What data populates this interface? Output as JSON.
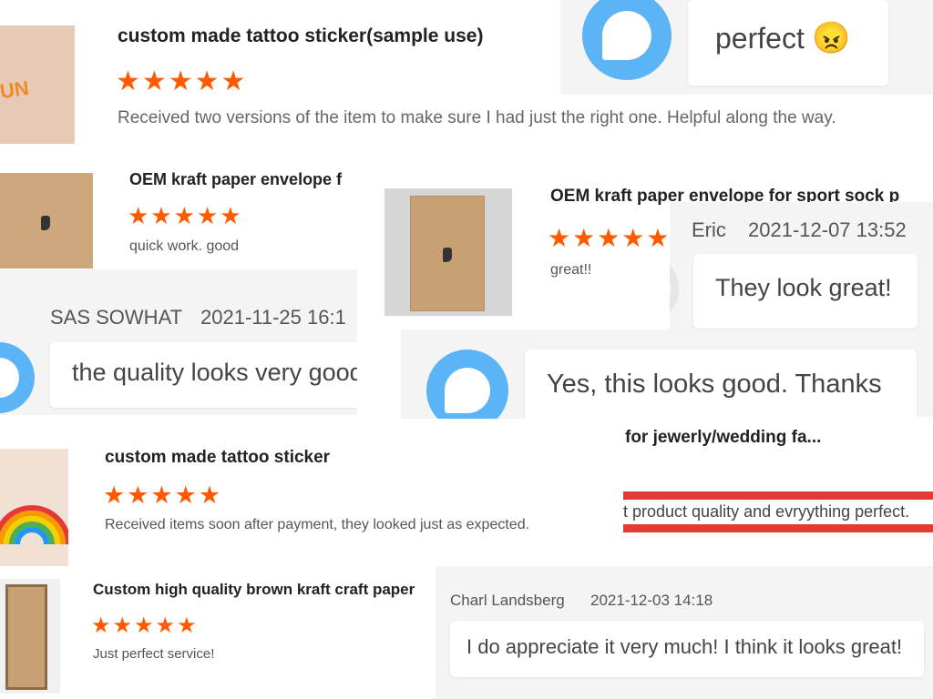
{
  "c1": {
    "title": "custom made tattoo sticker(sample use)",
    "stars": "★★★★★",
    "text": "Received two versions of the item to make sure I had just the right one.  Helpful along the way.",
    "thumb_text": "UN"
  },
  "c2": {
    "message": "perfect",
    "emoji": "😠"
  },
  "c3": {
    "title": "OEM kraft paper envelope f",
    "stars": "★★★★★",
    "text": "quick work. good"
  },
  "c4": {
    "title": "OEM kraft paper envelope for sport sock p",
    "stars": "★★★★★",
    "text": "great!!"
  },
  "c5": {
    "name": "Eric",
    "date": "2021-12-07 13:52",
    "message": "They look great!"
  },
  "c6": {
    "name": "SAS SOWHAT",
    "date": "2021-11-25 16:1",
    "message": "the quality looks very good"
  },
  "c7": {
    "message": "Yes, this looks good. Thanks"
  },
  "c8": {
    "title": "for jewerly/wedding fa...",
    "text": "t product quality and evryything perfect."
  },
  "c9": {
    "title": "custom made tattoo sticker",
    "stars": "★★★★★",
    "text": "Received items soon after payment, they looked just as expected."
  },
  "c10": {
    "title": "Custom high quality brown kraft craft paper",
    "stars": "★★★★★",
    "text": "Just perfect service!"
  },
  "c11": {
    "name": "Charl Landsberg",
    "date": "2021-12-03 14:18",
    "message": "I do appreciate it very much! I think it looks great!"
  },
  "colors": {
    "star": "#ff5a00",
    "bubble": "#5ab4f5",
    "accent_red": "#e53935"
  }
}
